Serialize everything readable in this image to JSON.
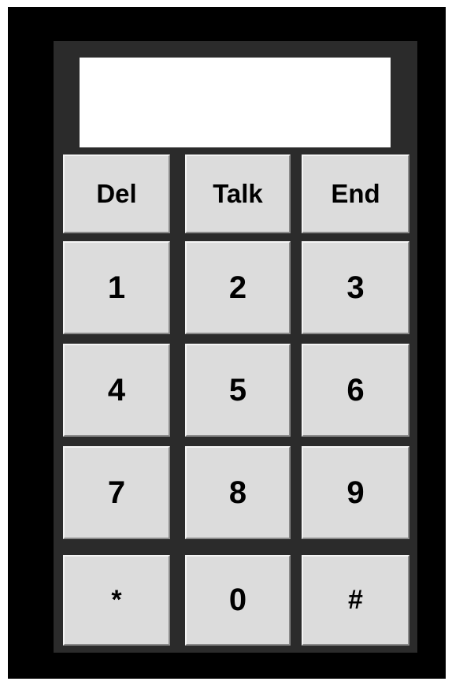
{
  "display": {
    "value": ""
  },
  "function_keys": {
    "del": "Del",
    "talk": "Talk",
    "end": "End"
  },
  "digits": {
    "k1": "1",
    "k2": "2",
    "k3": "3",
    "k4": "4",
    "k5": "5",
    "k6": "6",
    "k7": "7",
    "k8": "8",
    "k9": "9",
    "star": "*",
    "k0": "0",
    "hash": "#"
  },
  "colors": {
    "window_bg": "#000000",
    "body_bg": "#2b2b2b",
    "display_bg": "#ffffff",
    "key_bg": "#dcdcdc"
  }
}
